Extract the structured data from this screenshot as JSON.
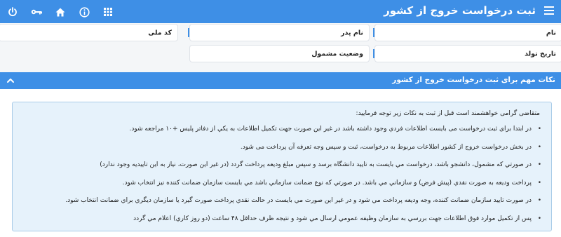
{
  "header": {
    "title": "ثبت درخواست خروج از کشور",
    "icons": [
      "menu-icon",
      "apps-grid-icon",
      "info-icon",
      "home-icon",
      "key-icon",
      "power-icon"
    ],
    "accent": "#3e8fe6"
  },
  "form": {
    "name_label": "نام",
    "father_name_label": "نام پدر",
    "national_code_label": "کد ملی",
    "birth_date_label": "تاریخ تولد",
    "conscription_status_label": "وضعیت مشمول"
  },
  "notes": {
    "panel_title": "نکات مهم برای ثبت درخواست خروج از کشور",
    "intro": "متقاضی گرامی خواهشمند است قبل از ثبت به نکات زیر توجه فرمایید:",
    "items": [
      "در ابتدا برای ثبت درخواست می بایست اطلاعات فردي وجود داشته باشد در غیر این صورت جهت تکمیل اطلاعات به یکي از دفاتر پلیس +۱۰ مراجعه شود.",
      "در بخش درخواست خروج از کشور اطلاعات مربوط به درخواست، ثبت و سپس وجه تعرفه آن پرداخت می شود.",
      "در صورتي که مشمول، دانشجو باشد، درخواست مي بايست به تاييد دانشگاه برسد و سپس مبلغ وديعه پرداخت گردد (در غير اين صورت، نياز به اين تاييديه وجود ندارد)",
      "پرداخت وديعه به صورت نقدي (پيش فرض) و سازماني مي باشد. در صورتي که نوع ضمانت سازماني باشد مي بايست سازمان ضمانت کننده نيز انتخاب شود.",
      "در صورت تایید سازمان ضمانت کننده، وجه ودیعه پرداخت مي شود و در غیر این صورت مي بایست در حالت نقدي پرداخت صورت گیرد یا سازمان دیگري براي ضمانت انتخاب شود.",
      "پس از تکمیل موارد فوق اطلاعات جهت بررسي به سازمان وظیفه عمومي ارسال مي شود و نتیجه ظرف حداقل ۴۸ ساعت (دو روز کاري) اعلام مي گردد"
    ]
  }
}
